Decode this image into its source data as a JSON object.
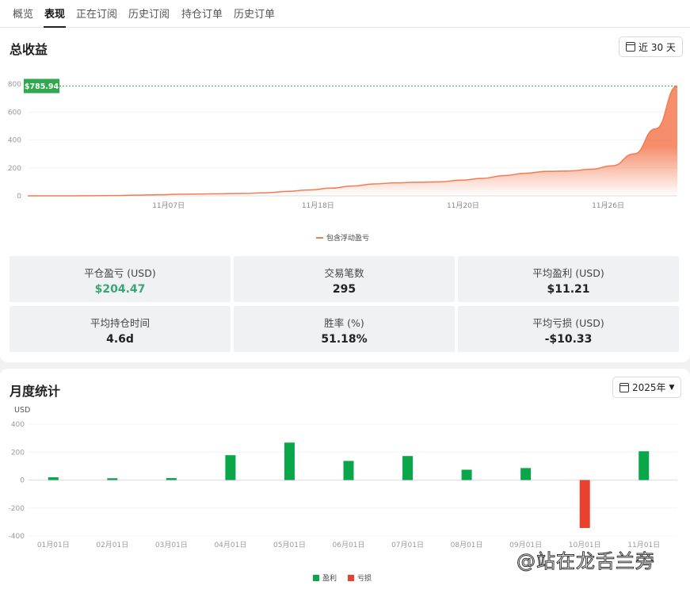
{
  "tabs": [
    {
      "label": "概览",
      "active": false
    },
    {
      "label": "表现",
      "active": true
    },
    {
      "label": "正在订阅",
      "active": false
    },
    {
      "label": "历史订阅",
      "active": false
    },
    {
      "label": "持仓订单",
      "active": false
    },
    {
      "label": "历史订单",
      "active": false
    }
  ],
  "total": {
    "title": "总收益",
    "range_button": "近 30 天",
    "range_icon": "calendar-icon"
  },
  "chart_data": [
    {
      "type": "area",
      "title": "总收益",
      "ylim": [
        0,
        800
      ],
      "yticks": [
        0,
        200,
        400,
        600,
        800
      ],
      "xtick_labels": [
        {
          "label": "11月07日",
          "index": 6.5
        },
        {
          "label": "11月18日",
          "index": 13.4
        },
        {
          "label": "11月20日",
          "index": 20.1
        },
        {
          "label": "11月26日",
          "index": 26.8
        }
      ],
      "series": [
        {
          "name": "包含浮动盈亏",
          "color": "#f47a52",
          "values": [
            0,
            0,
            0,
            1,
            2,
            5,
            8,
            11,
            13,
            15,
            17,
            22,
            32,
            42,
            55,
            70,
            85,
            93,
            97,
            100,
            112,
            125,
            145,
            162,
            175,
            178,
            190,
            215,
            300,
            480,
            785.94
          ]
        }
      ],
      "marker": {
        "label": "$785.94",
        "value": 785.94,
        "color": "#2fa84f"
      },
      "legend": "bottom",
      "grid": true
    },
    {
      "type": "bar",
      "title": "月度统计",
      "ylabel": "USD",
      "ylim": [
        -400,
        400
      ],
      "yticks": [
        -400,
        -200,
        0,
        200,
        400
      ],
      "categories": [
        "01月01日",
        "02月01日",
        "03月01日",
        "04月01日",
        "05月01日",
        "06月01日",
        "07月01日",
        "08月01日",
        "09月01日",
        "10月01日",
        "11月01日"
      ],
      "values": [
        20,
        13,
        14,
        178,
        268,
        137,
        172,
        74,
        86,
        -343,
        206
      ],
      "legend_entries": [
        {
          "name": "盈利",
          "color": "#0aa64a"
        },
        {
          "name": "亏损",
          "color": "#e8412f"
        }
      ],
      "legend": "bottom",
      "grid": true
    }
  ],
  "stats": [
    {
      "label": "平仓盈亏 (USD)",
      "value": "$204.47",
      "color": "#3aa57a"
    },
    {
      "label": "交易笔数",
      "value": "295"
    },
    {
      "label": "平均盈利 (USD)",
      "value": "$11.21"
    },
    {
      "label": "平均持仓时间",
      "value": "4.6d"
    },
    {
      "label": "胜率 (%)",
      "value": "51.18%"
    },
    {
      "label": "平均亏损 (USD)",
      "value": "-$10.33"
    }
  ],
  "monthly": {
    "title": "月度统计",
    "year_button": "2025年"
  },
  "watermark": "@站在龙舌兰旁"
}
